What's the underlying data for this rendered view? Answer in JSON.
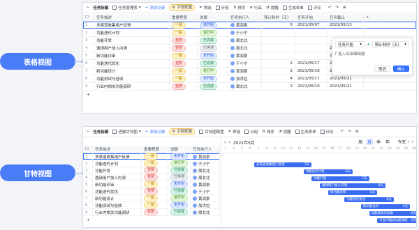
{
  "labels": {
    "table_view": "表格视图",
    "gantt_view": "甘特视图"
  },
  "toolbar_top": {
    "doc_title": "任务拆解",
    "view_name": "任务管理表",
    "add_record": "添加记录",
    "field_config": "字段配置",
    "filter": "筛选",
    "group": "分组",
    "sort": "排序",
    "row_height": "行高",
    "remind": "提醒",
    "gen_form": "生成表单",
    "comment": "评论"
  },
  "toolbar_bottom": {
    "doc_title": "任务拆解",
    "view_name": "进展甘特图",
    "add_record": "添加记录",
    "field_config": "字段配置",
    "gantt_config": "甘特图配置",
    "filter": "筛选",
    "group": "分组",
    "sort": "排序",
    "remind": "提醒",
    "gen_form": "生成表单",
    "comment": "评论"
  },
  "table": {
    "headers": [
      "任务描述",
      "重要程度",
      "进展",
      "任务执行人",
      "预计耗时（天）",
      "任务开始",
      "任务截止"
    ],
    "rows": [
      {
        "n": "1",
        "desc": "多渠道收集用户反馈",
        "pri": "一般",
        "pcls": "p-mid",
        "status": "未开始",
        "scls": "s-new",
        "owner": "黄润泉",
        "days": "6",
        "start": "2021/05/07",
        "end": "2021/05/13"
      },
      {
        "n": "2",
        "desc": "功能迭代计划",
        "pri": "一般",
        "pcls": "p-mid",
        "status": "进行中",
        "scls": "s-ing",
        "owner": "于小宁",
        "days": "",
        "start": "",
        "end": ""
      },
      {
        "n": "3",
        "desc": "功能开发",
        "pri": "重要",
        "pcls": "p-high",
        "status": "已完成",
        "scls": "s-done",
        "owner": "周北北",
        "days": "",
        "start": "",
        "end": ""
      },
      {
        "n": "4",
        "desc": "邀请用户加入内测",
        "pri": "重要",
        "pcls": "p-high",
        "status": "已停滞",
        "scls": "s-stop",
        "owner": "周北北",
        "days": "",
        "start": "",
        "end": "2021/05/16"
      },
      {
        "n": "5",
        "desc": "新功能评审",
        "pri": "一般",
        "pcls": "p-mid",
        "status": "未开始",
        "scls": "s-new",
        "owner": "黄润泉",
        "days": "",
        "start": "",
        "end": "2021/05/19"
      },
      {
        "n": "6",
        "desc": "功能迭代优化",
        "pri": "重要",
        "pcls": "p-high",
        "status": "已完成",
        "scls": "s-done",
        "owner": "于小宁",
        "days": "2",
        "start": "2021/05/17",
        "end": "2021/05/19"
      },
      {
        "n": "7",
        "desc": "新功能设计",
        "pri": "一般",
        "pcls": "p-mid",
        "status": "进行中",
        "scls": "s-ing",
        "owner": "黄润泉",
        "days": "2",
        "start": "2021/05/18",
        "end": "2021/05/20"
      },
      {
        "n": "8",
        "desc": "功能测试与验收",
        "pri": "一般",
        "pcls": "p-mid",
        "status": "未开始",
        "scls": "s-new",
        "owner": "加洪拉",
        "days": "4",
        "start": "2021/05/17",
        "end": "2021/05/21"
      },
      {
        "n": "9",
        "desc": "行业内相关功能调研",
        "pri": "重要",
        "pcls": "p-high",
        "status": "已完成",
        "scls": "s-done",
        "owner": "周北北",
        "days": "2",
        "start": "2021/05/19",
        "end": "2021/05/21"
      }
    ],
    "add_row": "+"
  },
  "popup": {
    "field": "任务开始",
    "op": "+",
    "target": "预计耗时（天）",
    "hint": "插入高级编辑器",
    "cancel": "取消",
    "confirm": "确认"
  },
  "gantt": {
    "headers": [
      "任务描述",
      "重要程度",
      "进展",
      "任务执行人"
    ],
    "month_label": "2021年5月",
    "zoom": [
      "周",
      "月",
      "季",
      "年"
    ],
    "today": "今天",
    "days": [
      "3",
      "4",
      "5",
      "6",
      "7",
      "8",
      "9",
      "10",
      "11",
      "12",
      "13",
      "14",
      "15",
      "16",
      "17",
      "18",
      "19",
      "20",
      "21",
      "22",
      "23",
      "24",
      "25",
      "26"
    ],
    "bars": [
      {
        "label": "多渠道收集用户反馈",
        "days": "7天",
        "start": 7,
        "len": 7
      },
      {
        "label": "功能迭代计划",
        "days": "6天",
        "start": 13,
        "len": 6
      },
      {
        "label": "功能开发",
        "days": "7天",
        "start": 14,
        "len": 7
      },
      {
        "label": "邀请用户加入内测",
        "days": "8天",
        "start": 15,
        "len": 8
      },
      {
        "label": "新功能评审",
        "days": "6天",
        "start": 16,
        "len": 6
      },
      {
        "label": "功能迭代优化",
        "days": "6天",
        "start": 18,
        "len": 6
      },
      {
        "label": "新功能设计",
        "days": "6天",
        "start": 20,
        "len": 6
      },
      {
        "label": "功能测试与验收",
        "days": "6天",
        "start": 21,
        "len": 6
      },
      {
        "label": "行业内相关功能调研",
        "days": "5天",
        "start": 22,
        "len": 5
      }
    ]
  }
}
